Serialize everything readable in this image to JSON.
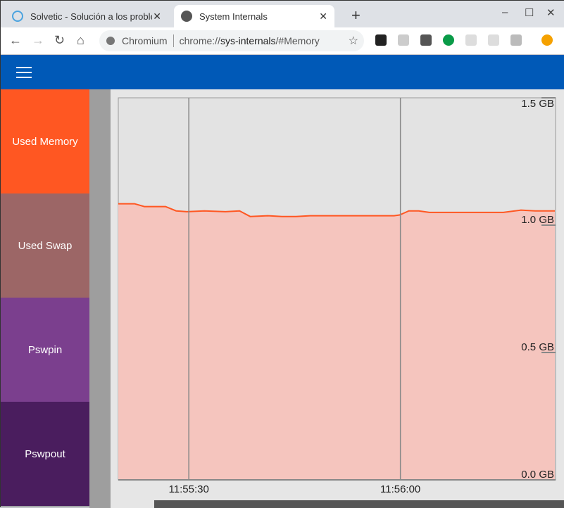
{
  "browser": {
    "tabs": [
      {
        "title": "Solvetic - Solución a los problemas"
      },
      {
        "title": "System Internals"
      }
    ],
    "omnibox": {
      "site": "Chromium",
      "url_prefix": "chrome://",
      "url_host": "sys-internals",
      "url_path": "/#Memory"
    }
  },
  "sidebar": {
    "items": [
      {
        "label": "Used Memory",
        "color": "#ff5722"
      },
      {
        "label": "Used Swap",
        "color": "#9c6666"
      },
      {
        "label": "Pswpin",
        "color": "#7b3f8e"
      },
      {
        "label": "Pswpout",
        "color": "#4a1d5e"
      }
    ]
  },
  "chart_data": {
    "type": "area",
    "title": "",
    "series": [
      {
        "name": "Used Memory",
        "color": "#ff5722",
        "fill": "#f5c5be",
        "t": [
          0,
          2.3,
          3.7,
          6.7,
          8.2,
          9.7,
          12.2,
          15.2,
          17.2,
          18.7,
          21.2,
          23.2,
          25.2,
          27.2,
          29.2,
          39.1,
          39.9,
          41.2,
          42.6,
          44.1,
          53.1,
          54.6,
          57.1,
          59.1,
          61.9
        ],
        "values": [
          1.084,
          1.084,
          1.073,
          1.073,
          1.056,
          1.053,
          1.056,
          1.053,
          1.056,
          1.034,
          1.037,
          1.034,
          1.034,
          1.037,
          1.037,
          1.037,
          1.04,
          1.056,
          1.056,
          1.05,
          1.05,
          1.05,
          1.059,
          1.056,
          1.056
        ]
      }
    ],
    "x_ticks": [
      {
        "t": 10,
        "label": "11:55:30"
      },
      {
        "t": 40,
        "label": "11:56:00"
      }
    ],
    "xlim": [
      0,
      62
    ],
    "y_ticks": [
      {
        "v": 0,
        "label": "0.0 GB"
      },
      {
        "v": 0.5,
        "label": "0.5 GB"
      },
      {
        "v": 1.0,
        "label": "1.0 GB"
      },
      {
        "v": 1.5,
        "label": "1.5 GB"
      }
    ],
    "ylim": [
      0,
      1.5
    ]
  }
}
